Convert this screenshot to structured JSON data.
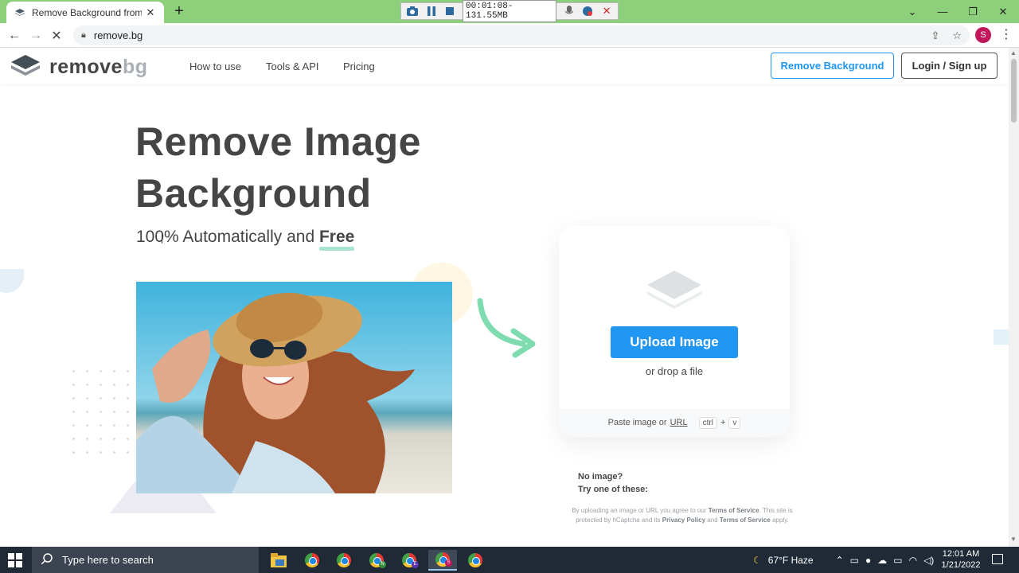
{
  "browser": {
    "tab_title": "Remove Background from Image",
    "url": "remove.bg",
    "profile_initial": "S",
    "recorder_time": "00:01:08-131.55MB"
  },
  "site": {
    "logo_main": "remove",
    "logo_suffix": "bg",
    "nav": [
      "How to use",
      "Tools & API",
      "Pricing"
    ],
    "remove_bg_button": "Remove Background",
    "login_button": "Login / Sign up"
  },
  "hero": {
    "title_line1": "Remove Image",
    "title_line2": "Background",
    "subtitle_prefix": "100% Automatically and",
    "subtitle_bold": "Free"
  },
  "upload": {
    "button": "Upload Image",
    "drop_text": "or drop a file",
    "paste_prefix": "Paste image or",
    "paste_link": "URL",
    "key_ctrl": "ctrl",
    "key_plus": "+",
    "key_v": "v"
  },
  "samples": {
    "line1": "No image?",
    "line2": "Try one of these:"
  },
  "legal": {
    "p1": "By uploading an image or URL you agree to our",
    "tos": "Terms of Service",
    "p2": ". This site is protected by hCaptcha and its",
    "privacy": "Privacy Policy",
    "p3": "and",
    "tos2": "Terms of Service",
    "p4": "apply."
  },
  "taskbar": {
    "search_placeholder": "Type here to search",
    "weather": "67°F  Haze",
    "time": "12:01 AM",
    "date": "1/21/2022",
    "apps": [
      "file-explorer",
      "chrome",
      "chrome",
      "chrome-n",
      "chrome-e",
      "chrome-s",
      "chrome"
    ],
    "badges": [
      "",
      "",
      "",
      "N",
      "E",
      "S",
      ""
    ]
  },
  "colors": {
    "accent": "#2196f3",
    "tabbar": "#8dd07c",
    "text": "#454545",
    "underline": "#a8e4cc",
    "arrow": "#7fdcb0"
  }
}
